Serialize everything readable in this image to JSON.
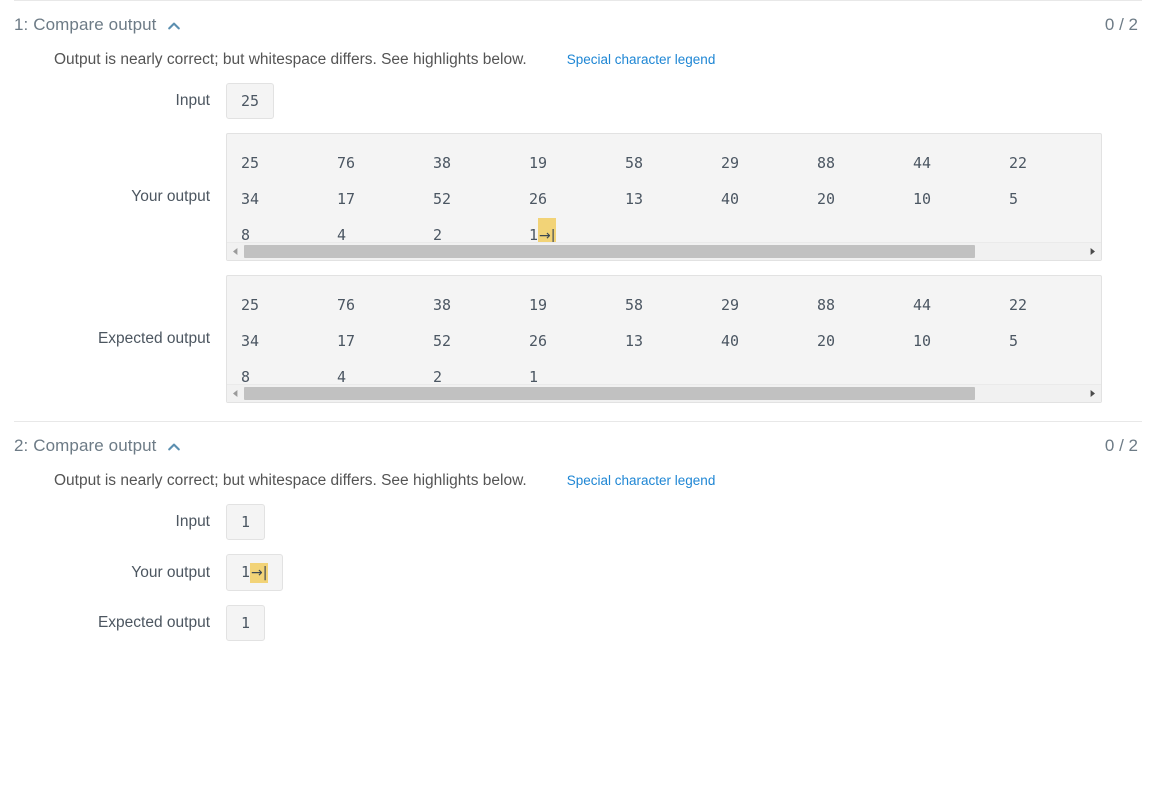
{
  "sections": [
    {
      "title": "1: Compare output",
      "collapse_icon": "chevron-up-icon",
      "score": "0 / 2",
      "message": "Output is nearly correct; but whitespace differs. See highlights below.",
      "legend_link": "Special character legend",
      "input_label": "Input",
      "input_value": "25",
      "your_output_label": "Your output",
      "expected_output_label": "Expected output",
      "your_output_rows": [
        [
          "25",
          "76",
          "38",
          "19",
          "58",
          "29",
          "88",
          "44",
          "22"
        ],
        [
          "34",
          "17",
          "52",
          "26",
          "13",
          "40",
          "20",
          "10",
          "5"
        ],
        [
          "8",
          "4",
          "2",
          "1"
        ]
      ],
      "your_output_tab_marker": "→|",
      "expected_output_rows": [
        [
          "25",
          "76",
          "38",
          "19",
          "58",
          "29",
          "88",
          "44",
          "22"
        ],
        [
          "34",
          "17",
          "52",
          "26",
          "13",
          "40",
          "20",
          "10",
          "5"
        ],
        [
          "8",
          "4",
          "2",
          "1"
        ]
      ],
      "scroll_left_arrow": "scroll-left-arrow-icon",
      "scroll_right_arrow": "scroll-right-arrow-icon"
    },
    {
      "title": "2: Compare output",
      "collapse_icon": "chevron-up-icon",
      "score": "0 / 2",
      "message": "Output is nearly correct; but whitespace differs. See highlights below.",
      "legend_link": "Special character legend",
      "input_label": "Input",
      "input_value": "1",
      "your_output_label": "Your output",
      "your_output_value": "1",
      "your_output_tab_marker": "→|",
      "expected_output_label": "Expected output",
      "expected_output_value": "1"
    }
  ],
  "colors": {
    "link": "#1e86d4",
    "highlight": "#f2d377",
    "panel_bg": "#f4f4f4",
    "muted_text": "#6d7b86"
  }
}
